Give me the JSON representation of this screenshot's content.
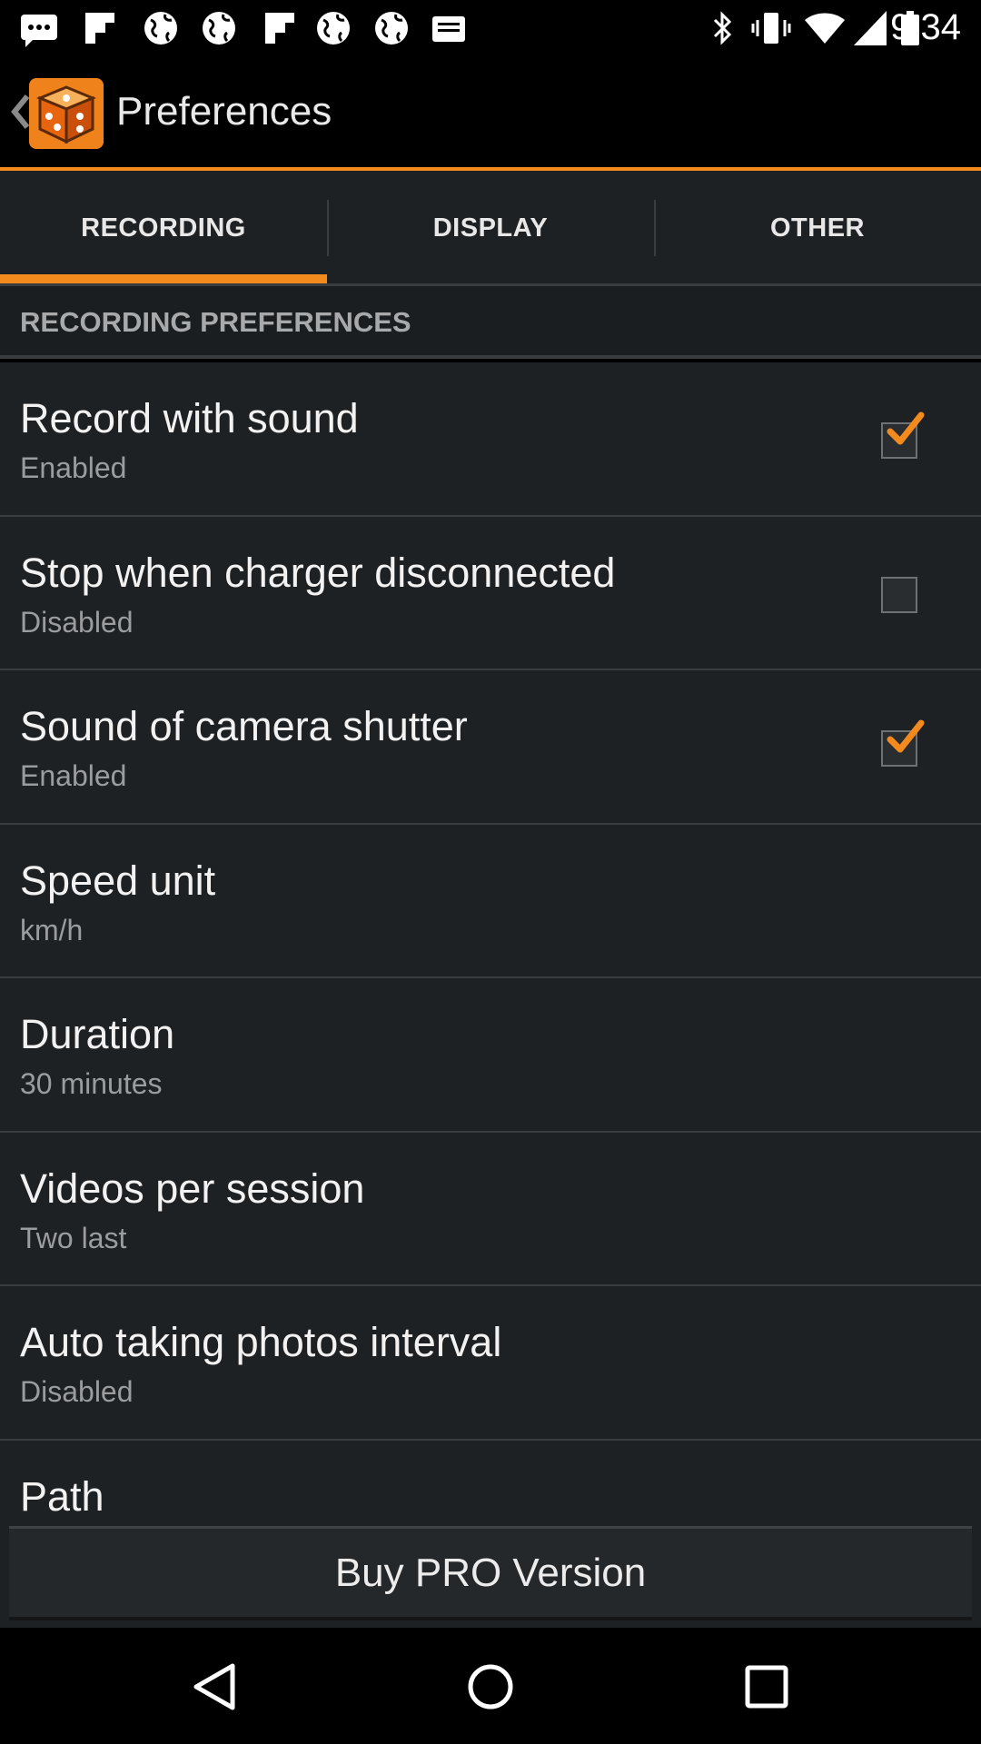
{
  "status_bar": {
    "time": "9:34",
    "left_icons": [
      "chat-icon",
      "flipboard-icon",
      "globe-icon",
      "globe-icon",
      "flipboard-icon",
      "globe-icon",
      "globe-icon",
      "message-icon"
    ],
    "right_icons": [
      "bluetooth-icon",
      "vibrate-icon",
      "wifi-icon",
      "signal-icon",
      "battery-icon"
    ]
  },
  "action_bar": {
    "title": "Preferences",
    "back_icon": "chevron-left-icon",
    "app_icon": "dice-app-icon"
  },
  "tabs": [
    {
      "label": "RECORDING",
      "active": true
    },
    {
      "label": "DISPLAY",
      "active": false
    },
    {
      "label": "OTHER",
      "active": false
    }
  ],
  "section": {
    "title": "RECORDING PREFERENCES"
  },
  "items": [
    {
      "title": "Record with sound",
      "summary": "Enabled",
      "checkbox": true,
      "checked": true
    },
    {
      "title": "Stop when charger disconnected",
      "summary": "Disabled",
      "checkbox": true,
      "checked": false
    },
    {
      "title": "Sound of camera shutter",
      "summary": "Enabled",
      "checkbox": true,
      "checked": true
    },
    {
      "title": "Speed unit",
      "summary": "km/h",
      "checkbox": false
    },
    {
      "title": "Duration",
      "summary": "30 minutes",
      "checkbox": false
    },
    {
      "title": "Videos per session",
      "summary": "Two last",
      "checkbox": false
    },
    {
      "title": "Auto taking photos interval",
      "summary": "Disabled",
      "checkbox": false
    },
    {
      "title": "Path",
      "summary": "",
      "checkbox": false
    }
  ],
  "buy_button": {
    "label": "Buy PRO Version"
  },
  "nav_bar": {
    "icons": [
      "back-triangle-icon",
      "home-circle-icon",
      "recents-square-icon"
    ]
  },
  "colors": {
    "accent": "#f28a1e",
    "background": "#1e2124",
    "divider": "#3a3d40"
  }
}
